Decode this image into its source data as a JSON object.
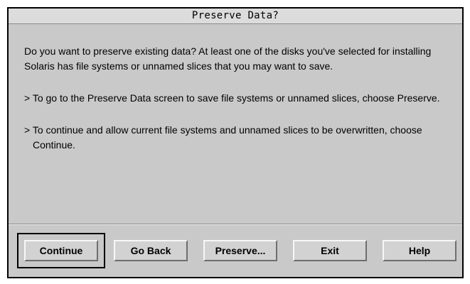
{
  "dialog": {
    "title": "Preserve Data?",
    "message": {
      "intro": "Do you want to preserve existing data? At least one of the disks you've selected for installing Solaris has file systems or unnamed slices that you may want to save.",
      "option_preserve": "> To go to the Preserve Data screen to save file systems or unnamed slices, choose Preserve.",
      "option_continue": "> To continue and allow current file systems and unnamed slices to be overwritten, choose Continue."
    },
    "buttons": {
      "continue": "Continue",
      "go_back": "Go Back",
      "preserve": "Preserve...",
      "exit": "Exit",
      "help": "Help"
    },
    "default_button": "Continue",
    "colors": {
      "background": "#c9c9c9",
      "title_bar": "#dcdcdc",
      "button_face": "#d2d2d2",
      "text": "#000000"
    }
  }
}
